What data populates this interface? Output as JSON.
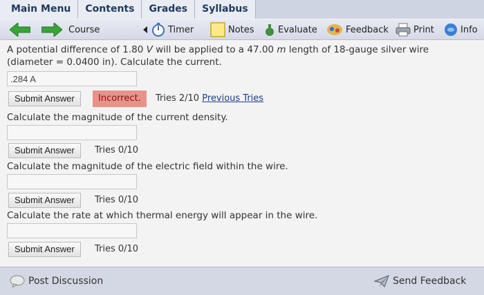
{
  "tabs": [
    "Main Menu",
    "Contents",
    "Grades",
    "Syllabus"
  ],
  "toolbar": {
    "course": "Course",
    "timer": "Timer",
    "notes": "Notes",
    "evaluate": "Evaluate",
    "feedback": "Feedback",
    "print": "Print",
    "info": "Info"
  },
  "problem": {
    "line1_prefix": "A potential difference of 1.80 ",
    "line1_v": "V",
    "line1_mid": " will be applied to a 47.00 ",
    "line1_m": "m",
    "line1_suffix": " length of 18-gauge silver wire",
    "line2": "(diameter = 0.0400 in). Calculate the current."
  },
  "parts": [
    {
      "answer": ".284 A",
      "submit_label": "Submit Answer",
      "status": "Incorrect.",
      "tries": "Tries 2/10",
      "previous_tries": "Previous Tries"
    },
    {
      "question": "Calculate the magnitude of the current density.",
      "answer": "",
      "submit_label": "Submit Answer",
      "tries": "Tries 0/10"
    },
    {
      "question": "Calculate the magnitude of the electric field within the wire.",
      "answer": "",
      "submit_label": "Submit Answer",
      "tries": "Tries 0/10"
    },
    {
      "question": "Calculate the rate at which thermal energy will appear in the wire.",
      "answer": "",
      "submit_label": "Submit Answer",
      "tries": "Tries 0/10"
    }
  ],
  "bottom": {
    "post_discussion": "Post Discussion",
    "send_feedback": "Send Feedback"
  },
  "colors": {
    "incorrect_bg": "#e8928a",
    "arrow_green": "#3aa33a",
    "link_blue": "#1a3c8a"
  }
}
